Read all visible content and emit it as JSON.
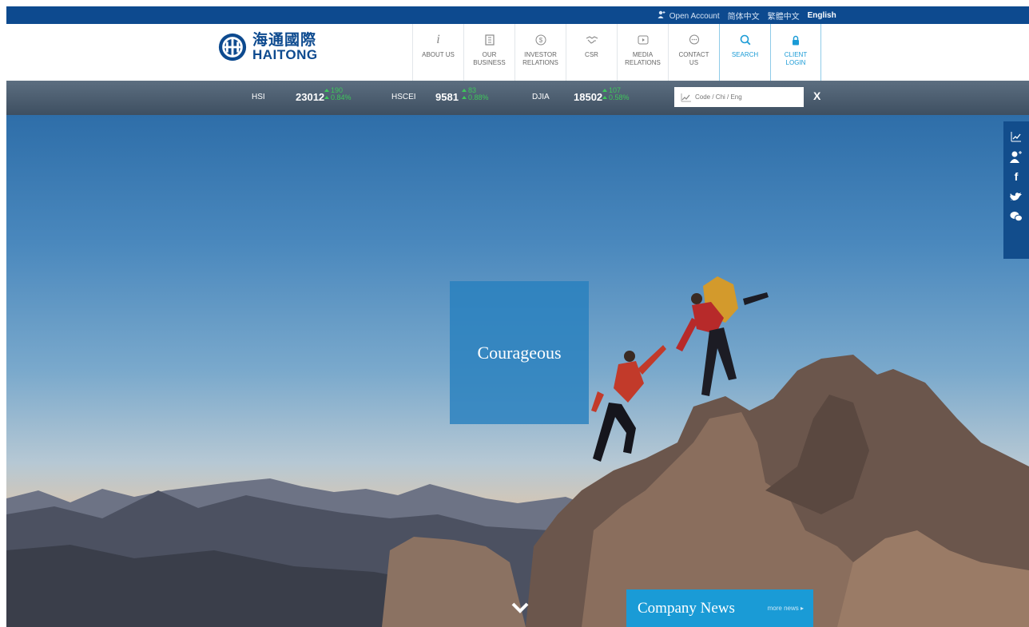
{
  "topbar": {
    "open_account": "Open Account",
    "lang_simplified": "简体中文",
    "lang_traditional": "繁體中文",
    "lang_english": "English"
  },
  "logo": {
    "cn": "海通國際",
    "en": "HAITONG"
  },
  "nav": [
    {
      "label": "ABOUT US",
      "icon": "info-icon"
    },
    {
      "label": "OUR\nBUSINESS",
      "icon": "building-icon"
    },
    {
      "label": "INVESTOR\nRELATIONS",
      "icon": "dollar-icon"
    },
    {
      "label": "CSR",
      "icon": "handshake-icon"
    },
    {
      "label": "MEDIA\nRELATIONS",
      "icon": "play-icon"
    },
    {
      "label": "CONTACT\nUS",
      "icon": "chat-icon"
    },
    {
      "label": "SEARCH",
      "icon": "search-icon"
    },
    {
      "label": "CLIENT\nLOGIN",
      "icon": "lock-icon"
    }
  ],
  "ticker": [
    {
      "name": "HSI",
      "value": "23012",
      "change": "190",
      "pct": "0.84%"
    },
    {
      "name": "HSCEI",
      "value": "9581",
      "change": "83",
      "pct": "0.88%"
    },
    {
      "name": "DJIA",
      "value": "18502",
      "change": "107",
      "pct": "0.58%"
    }
  ],
  "stock_search": {
    "placeholder": "Code / Chi / Eng",
    "close": "X"
  },
  "hero": {
    "badge": "Courageous"
  },
  "news": {
    "title": "Company News",
    "more": "more news"
  },
  "colors": {
    "brand_blue": "#0d4a8f",
    "accent_blue": "#1a9bd6",
    "up_green": "#3ec85a"
  }
}
